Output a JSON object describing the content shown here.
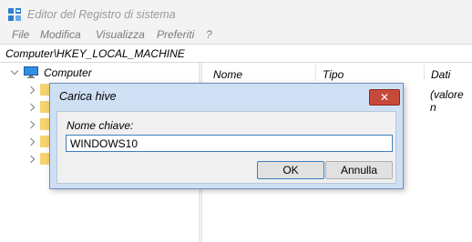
{
  "window": {
    "title": "Editor del Registro di sistema",
    "icon": "registry-editor-icon"
  },
  "menu": {
    "items": [
      "File",
      "Modifica",
      "Visualizza",
      "Preferiti",
      "?"
    ]
  },
  "address": {
    "path": "Computer\\HKEY_LOCAL_MACHINE"
  },
  "tree": {
    "root_label": "Computer",
    "root_icon": "computer-icon",
    "child_icon": "folder-icon"
  },
  "list": {
    "columns": [
      "Nome",
      "Tipo",
      "Dati"
    ],
    "first_row_data": "(valore n"
  },
  "dialog": {
    "title": "Carica hive",
    "field_label": "Nome chiave:",
    "field_value": "WINDOWS10",
    "ok_label": "OK",
    "cancel_label": "Annulla",
    "close_icon": "close-icon"
  },
  "colors": {
    "folder": "#f6d36f",
    "dialog_frame": "#cfe0f5",
    "close_button": "#c7493a",
    "focus_border": "#3c7fc1"
  }
}
